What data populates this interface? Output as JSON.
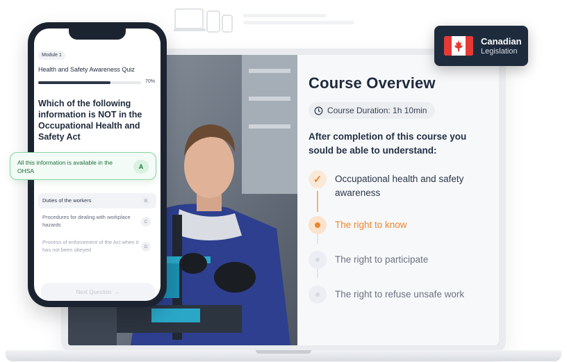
{
  "phone": {
    "module_label": "Module 1",
    "quiz_title": "Health and Safety Awareness Quiz",
    "progress_percent_label": "70%",
    "progress_fraction": 0.7,
    "question": "Which of the following information is NOT in the Occupational Health and Safety Act",
    "options": [
      {
        "text": "All this information is available in the OHSA",
        "letter": "A"
      },
      {
        "text": "Duties of the workers",
        "letter": "B"
      },
      {
        "text": "Procedures for dealing with workplace hazards",
        "letter": "C"
      },
      {
        "text": "Process of enforcement of the Act when it has not been obeyed",
        "letter": "D"
      }
    ],
    "next_button": "Next Question",
    "next_arrow": "→"
  },
  "badge": {
    "line1": "Canadian",
    "line2": "Legislation",
    "flag_icon": "canada-flag-icon"
  },
  "overview": {
    "title": "Course Overview",
    "duration": "Course Duration: 1h 10min",
    "subtitle": "After completion of this course you sould be able to understand:",
    "steps": [
      {
        "label": "Occupational health and safety awareness",
        "state": "done",
        "marker": "✓"
      },
      {
        "label": "The right to know",
        "state": "active"
      },
      {
        "label": "The right to participate",
        "state": "todo"
      },
      {
        "label": "The right to refuse unsafe work",
        "state": "todo"
      }
    ]
  },
  "colors": {
    "accent_orange": "#e8872e",
    "dark_navy": "#1e2b3d",
    "success_green": "#1d7a43"
  }
}
